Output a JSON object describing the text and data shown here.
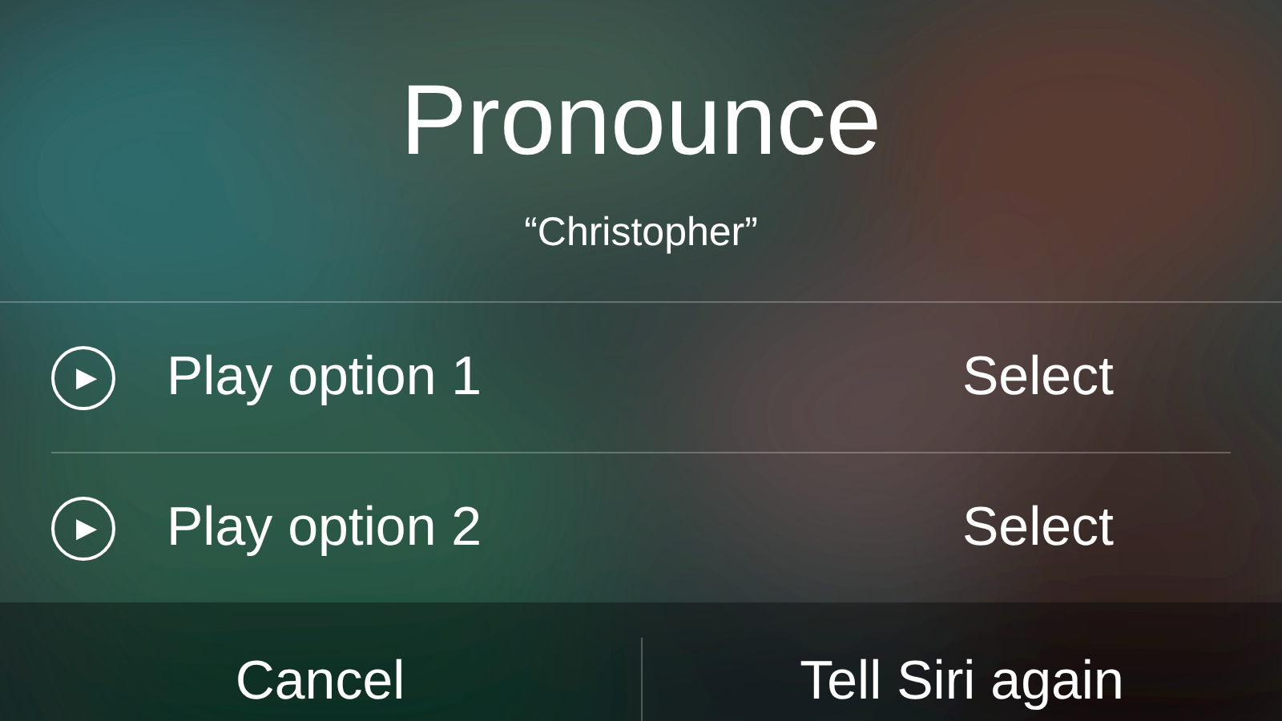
{
  "title": "Pronounce",
  "word": "“Christopher”",
  "options": [
    {
      "play_symbol": "▶",
      "label": "Play option 1",
      "action": "Select"
    },
    {
      "play_symbol": "▶",
      "label": "Play option 2",
      "action": "Select"
    }
  ],
  "buttons": [
    "Cancel",
    "Tell Siri again"
  ]
}
